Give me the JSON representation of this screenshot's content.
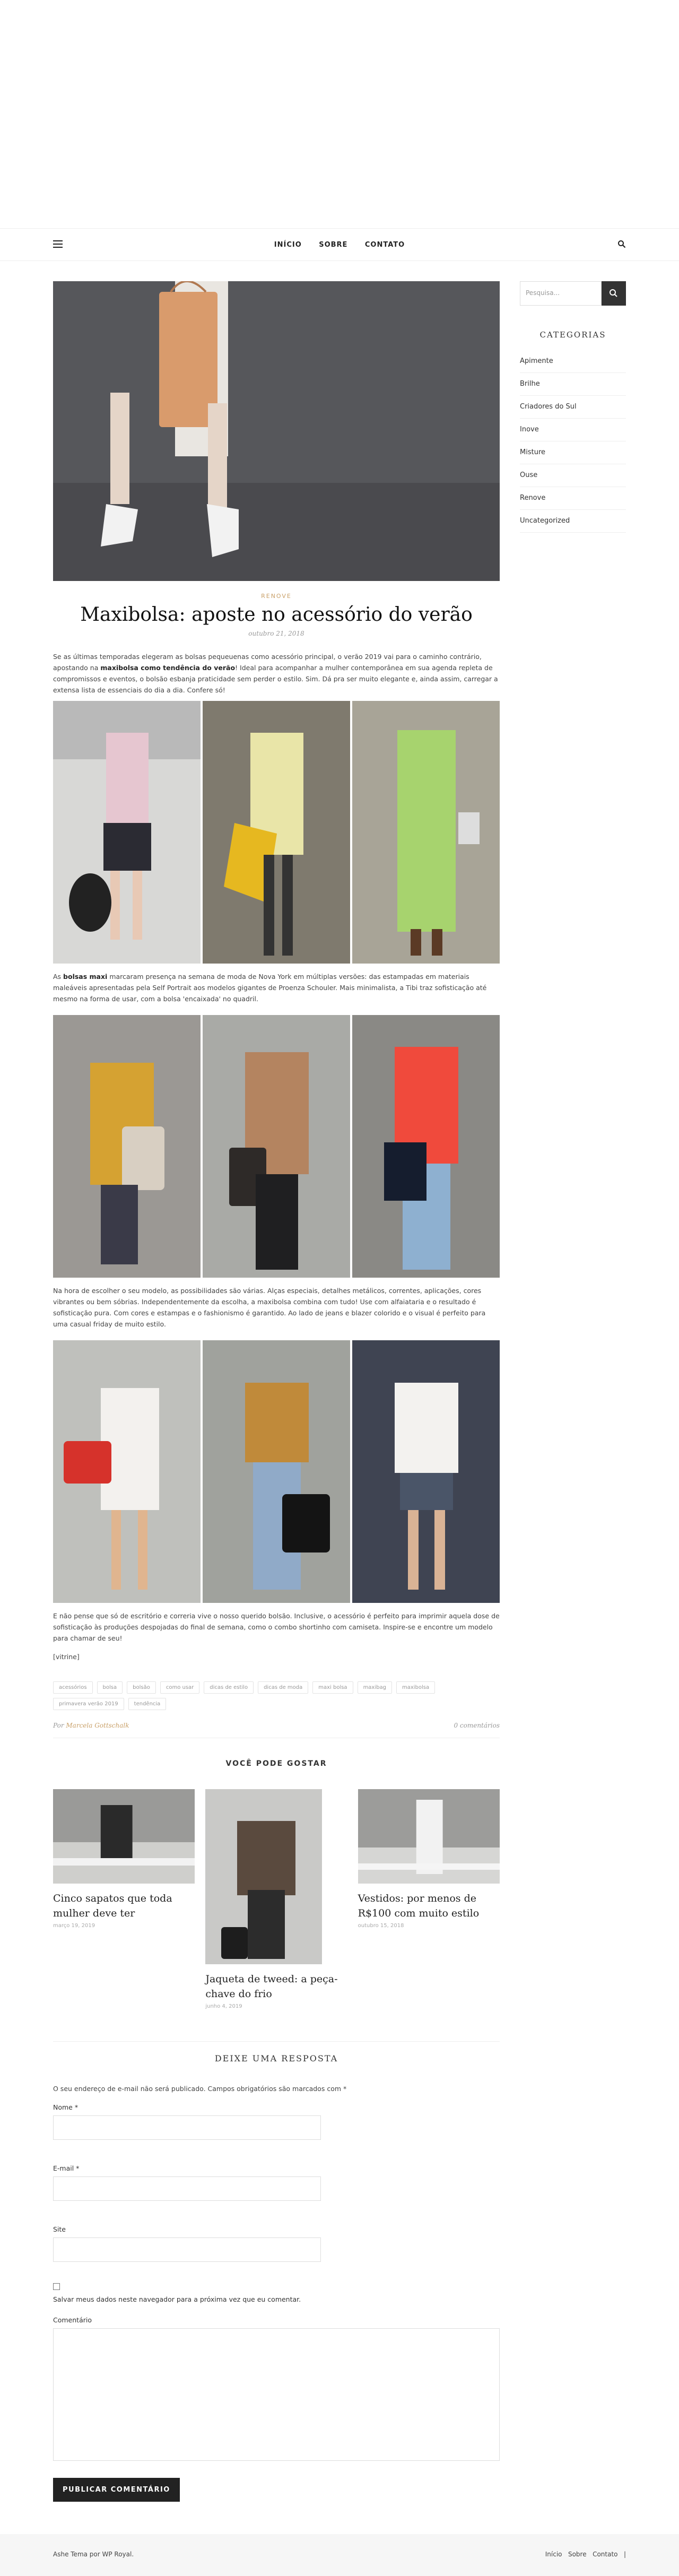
{
  "nav": {
    "items": [
      "INÍCIO",
      "SOBRE",
      "CONTATO"
    ]
  },
  "post": {
    "category": "RENOVE",
    "title": "Maxibolsa: aposte no acessório do verão",
    "date": "outubro 21, 2018",
    "p1_a": "Se as últimas temporadas elegeram as bolsas pequeuenas como acessório principal, o verão 2019 vai para o caminho contrário, apostando na ",
    "p1_b": "maxibolsa como tendência do verão",
    "p1_c": "! Ideal para acompanhar a mulher contemporânea em sua agenda repleta de compromissos e eventos, o bolsão esbanja praticidade sem perder o estilo. Sim. Dá pra ser muito elegante e, ainda assim, carregar a extensa lista de essenciais do dia a dia. Confere só!",
    "p2_a": "As ",
    "p2_b": "bolsas maxi",
    "p2_c": " marcaram presença na semana de moda de Nova York em múltiplas versões: das estampadas em materiais maleáveis apresentadas pela Self Portrait aos modelos gigantes de Proenza Schouler. Mais minimalista, a Tibi traz sofisticação até mesmo na forma de usar, com a bolsa 'encaixada' no quadril.",
    "p3": "Na hora de escolher o seu modelo, as possibilidades são várias. Alças especiais, detalhes metálicos, correntes, aplicações, cores vibrantes ou bem sóbrias. Independentemente da escolha, a maxibolsa combina com tudo! Use com alfaiataria e o resultado é sofisticação pura. Com cores e estampas e o fashionismo é garantido. Ao lado de jeans e blazer colorido e o visual é perfeito para uma casual friday de muito estilo.",
    "p4": "E não pense que só de escritório e correria vive o nosso querido bolsão. Inclusive, o acessório é perfeito para imprimir aquela dose de sofisticação às produções despojadas do final de semana, como o combo shortinho com camiseta. Inspire-se e encontre um modelo para chamar de seu!",
    "shortcode": "[vitrine]",
    "tags": [
      "acessórios",
      "bolsa",
      "bolsão",
      "como usar",
      "dicas de estilo",
      "dicas de moda",
      "maxi bolsa",
      "maxibag",
      "maxibolsa",
      "primavera verão 2019",
      "tendência"
    ],
    "author_prefix": "Por",
    "author": "Marcela Gottschalk",
    "comments": "0 comentários"
  },
  "related": {
    "heading": "VOCÊ PODE GOSTAR",
    "items": [
      {
        "title": "Cinco sapatos que toda mulher deve ter",
        "date": "março 19, 2019"
      },
      {
        "title": "Jaqueta de tweed: a peça-chave do frio",
        "date": "junho 4, 2019"
      },
      {
        "title": "Vestidos: por menos de R$100 com muito estilo",
        "date": "outubro 15, 2018"
      }
    ]
  },
  "reply": {
    "heading": "DEIXE UMA RESPOSTA",
    "notes": "O seu endereço de e-mail não será publicado. Campos obrigatórios são marcados com *",
    "name_label": "Nome *",
    "email_label": "E-mail *",
    "site_label": "Site",
    "save_label": "Salvar meus dados neste navegador para a próxima vez que eu comentar.",
    "comment_label": "Comentário",
    "submit": "PUBLICAR COMENTÁRIO"
  },
  "sidebar": {
    "search_placeholder": "Pesquisa...",
    "categories_heading": "CATEGORIAS",
    "categories": [
      "Apimente",
      "Brilhe",
      "Criadores do Sul",
      "Inove",
      "Misture",
      "Ouse",
      "Renove",
      "Uncategorized"
    ]
  },
  "footer": {
    "left": "Ashe Tema por WP Royal.",
    "links": [
      "Início",
      "Sobre",
      "Contato",
      "|"
    ]
  },
  "colors": {
    "accent": "#c9a068",
    "dark": "#222222"
  },
  "icons": [
    "menu-icon",
    "search-icon"
  ]
}
